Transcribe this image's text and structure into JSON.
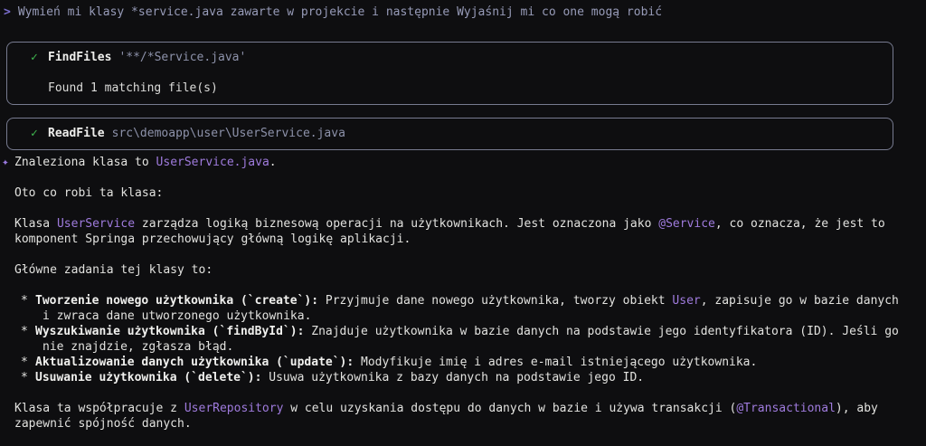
{
  "colors": {
    "background": "#0e0e10",
    "body_text": "#e2e2df",
    "accent_purple": "#9f7bdd",
    "prompt_marker_purple": "#7b6fd0",
    "prompt_text_gray": "#979bb8",
    "success_green": "#3fb84f",
    "muted_argument_blue_gray": "#8d92aa",
    "box_border": "#777b90"
  },
  "prompt": {
    "marker": ">",
    "text": "Wymień mi klasy *service.java zawarte w projekcie i następnie Wyjaśnij mi co one mogą robić"
  },
  "tools": [
    {
      "status_icon": "✓",
      "name": "FindFiles",
      "arg": "'**/*Service.java'",
      "result": "Found 1 matching file(s)"
    },
    {
      "status_icon": "✓",
      "name": "ReadFile",
      "arg": "src\\demoapp\\user\\UserService.java"
    }
  ],
  "response": {
    "marker": "✦",
    "intro": {
      "pre": "Znaleziona klasa to ",
      "code": "UserService.java",
      "post": "."
    },
    "p1": "Oto co robi ta klasa:",
    "p2": {
      "s0": "Klasa ",
      "code1": "UserService",
      "s1": " zarządza logiką biznesową operacji na użytkownikach. Jest oznaczona jako ",
      "code2": "@Service",
      "s2": ", co oznacza, że jest to komponent Springa przechowujący główną logikę aplikacji."
    },
    "p3": "Główne zadania tej klasy to:",
    "bullets": [
      {
        "marker": "*",
        "bold": "Tworzenie nowego użytkownika (`create`):",
        "t0": " Przyjmuje dane nowego użytkownika, tworzy obiekt ",
        "code": "User",
        "t1": ", zapisuje go w bazie danych i zwraca dane utworzonego użytkownika."
      },
      {
        "marker": "*",
        "bold": "Wyszukiwanie użytkownika (`findById`):",
        "t0": " Znajduje użytkownika w bazie danych na podstawie jego identyfikatora (ID). Jeśli go nie znajdzie, zgłasza błąd."
      },
      {
        "marker": "*",
        "bold": "Aktualizowanie danych użytkownika (`update`):",
        "t0": " Modyfikuje imię i adres e-mail istniejącego użytkownika."
      },
      {
        "marker": "*",
        "bold": "Usuwanie użytkownika (`delete`):",
        "t0": " Usuwa użytkownika z bazy danych na podstawie jego ID."
      }
    ],
    "p4": {
      "s0": "Klasa ta współpracuje z ",
      "code1": "UserRepository",
      "s1": " w celu uzyskania dostępu do danych w bazie i używa transakcji (",
      "code2": "@Transactional",
      "s2": "), aby zapewnić spójność danych."
    }
  }
}
